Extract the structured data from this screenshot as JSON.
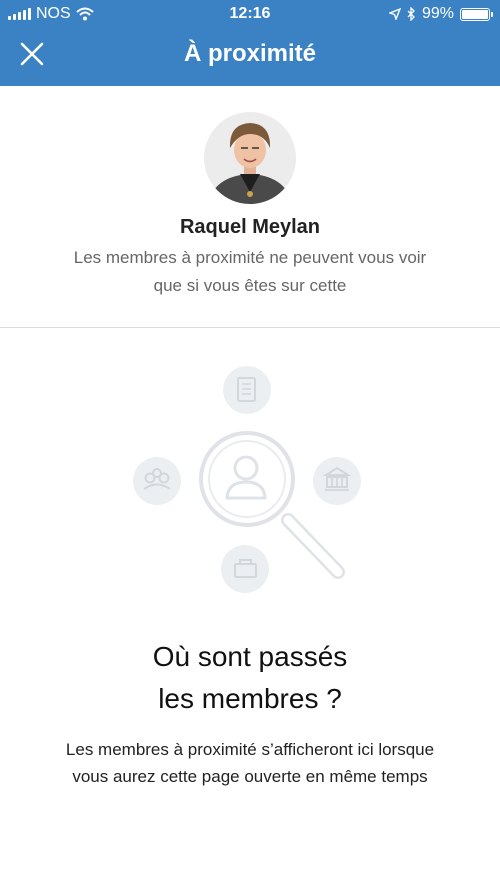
{
  "status_bar": {
    "carrier": "NOS",
    "time": "12:16",
    "battery": "99%",
    "battery_level": 0.99
  },
  "header": {
    "title": "À proximité"
  },
  "profile": {
    "name": "Raquel Meylan",
    "description": "Les membres à proximité ne peuvent vous voir que si vous êtes sur cette"
  },
  "empty_state": {
    "title_line1": "Où sont passés",
    "title_line2": "les membres ?",
    "description": "Les membres à proximité s’afficheront ici lorsque vous aurez cette page ouverte en même temps"
  },
  "colors": {
    "header_bg": "#3b82c4",
    "illustration": "#dfe3e8"
  },
  "icons": [
    "close-icon",
    "document-icon",
    "community-icon",
    "institution-icon",
    "briefcase-icon",
    "magnifier-person-icon"
  ]
}
